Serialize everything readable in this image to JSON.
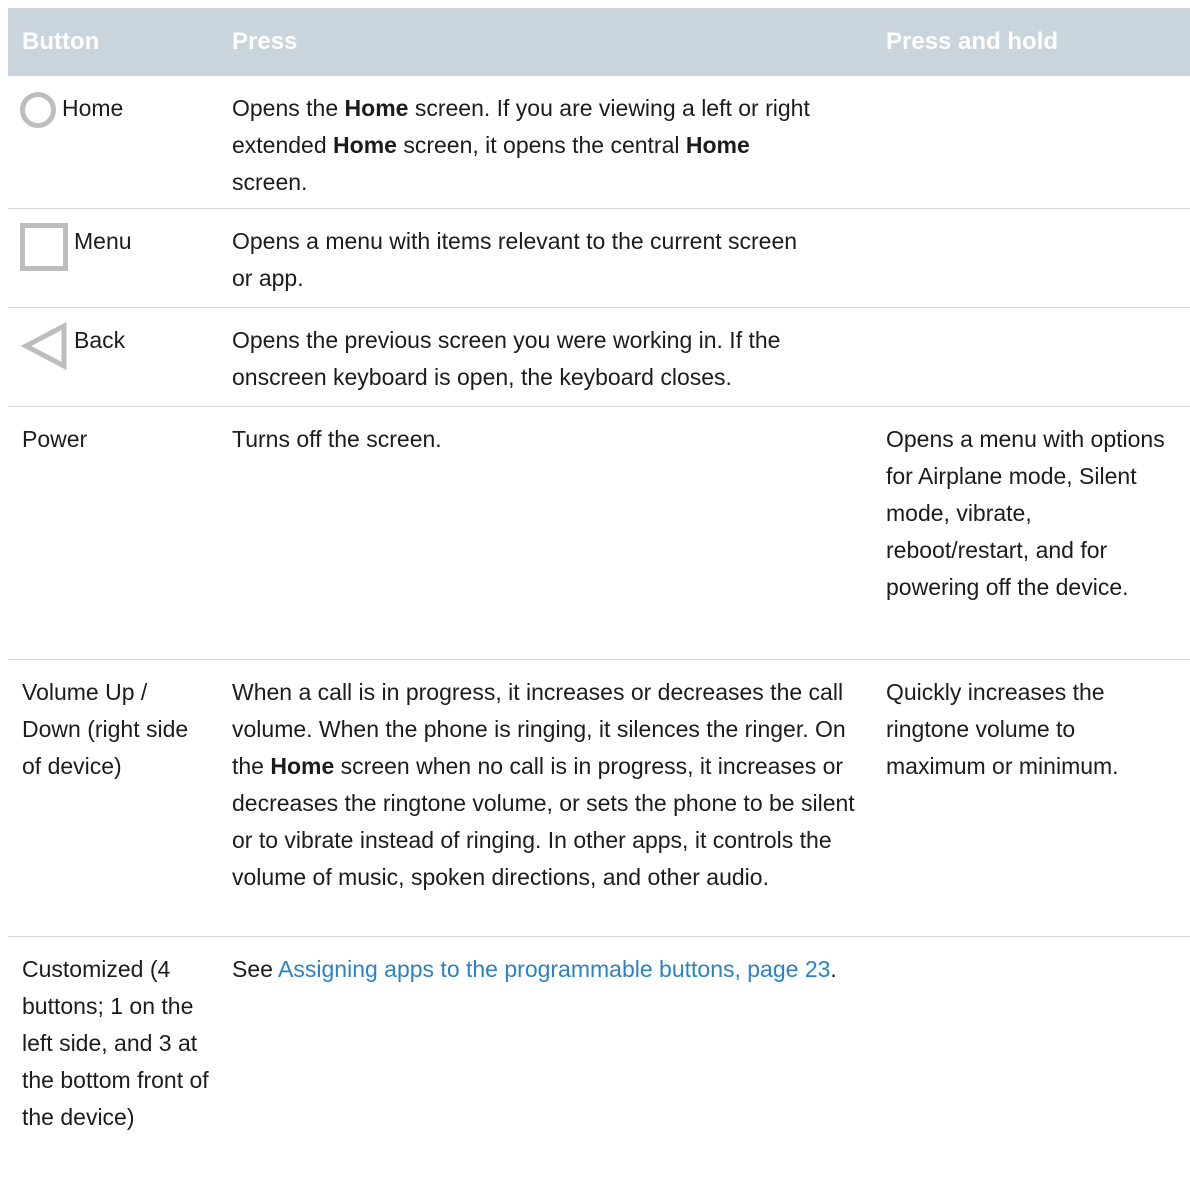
{
  "header": {
    "button": "Button",
    "press": "Press",
    "press_hold": "Press and hold"
  },
  "rows": [
    {
      "button": "Home",
      "icon": "circle-home-icon",
      "press": {
        "p1": "Opens the ",
        "b1": "Home",
        "p2": " screen. If you are viewing a left or right extended ",
        "b2": "Home",
        "p3": " screen, it opens the central ",
        "b3": "Home",
        "p4": " screen."
      },
      "press_hold": ""
    },
    {
      "button": "Menu",
      "icon": "square-menu-icon",
      "press": "Opens a menu with items relevant to the current screen or app.",
      "press_hold": ""
    },
    {
      "button": "Back",
      "icon": "triangle-back-icon",
      "press": "Opens the previous screen you were working in. If the onscreen keyboard is open, the keyboard closes.",
      "press_hold": ""
    },
    {
      "button": "Power",
      "press": "Turns off the screen.",
      "press_hold": "Opens a menu with options for Airplane mode, Silent mode, vibrate, reboot/restart, and for powering off the device."
    },
    {
      "button": "Volume Up / Down (right side of device)",
      "press": {
        "p1": "When a call is in progress, it increases or decreases the call volume. When the phone is ringing, it silences the ringer. On the ",
        "b1": "Home",
        "p2": " screen when no call is in progress, it increases or decreases the ringtone volume, or sets the phone to be silent or to vibrate instead of ringing. In other apps, it controls the volume of music, spoken directions, and other audio."
      },
      "press_hold": "Quickly increases the ringtone volume to maximum or minimum."
    },
    {
      "button": "Customized (4 buttons; 1 on the left side, and 3 at the bottom front of the device)",
      "press": {
        "p1": "See ",
        "link": "Assigning apps to the programmable buttons, page 23",
        "p2": "."
      },
      "press_hold": ""
    }
  ],
  "colors": {
    "header_bg": "#c9d4dd",
    "link": "#2b82c4",
    "icon_gray": "#bdbdbd"
  }
}
